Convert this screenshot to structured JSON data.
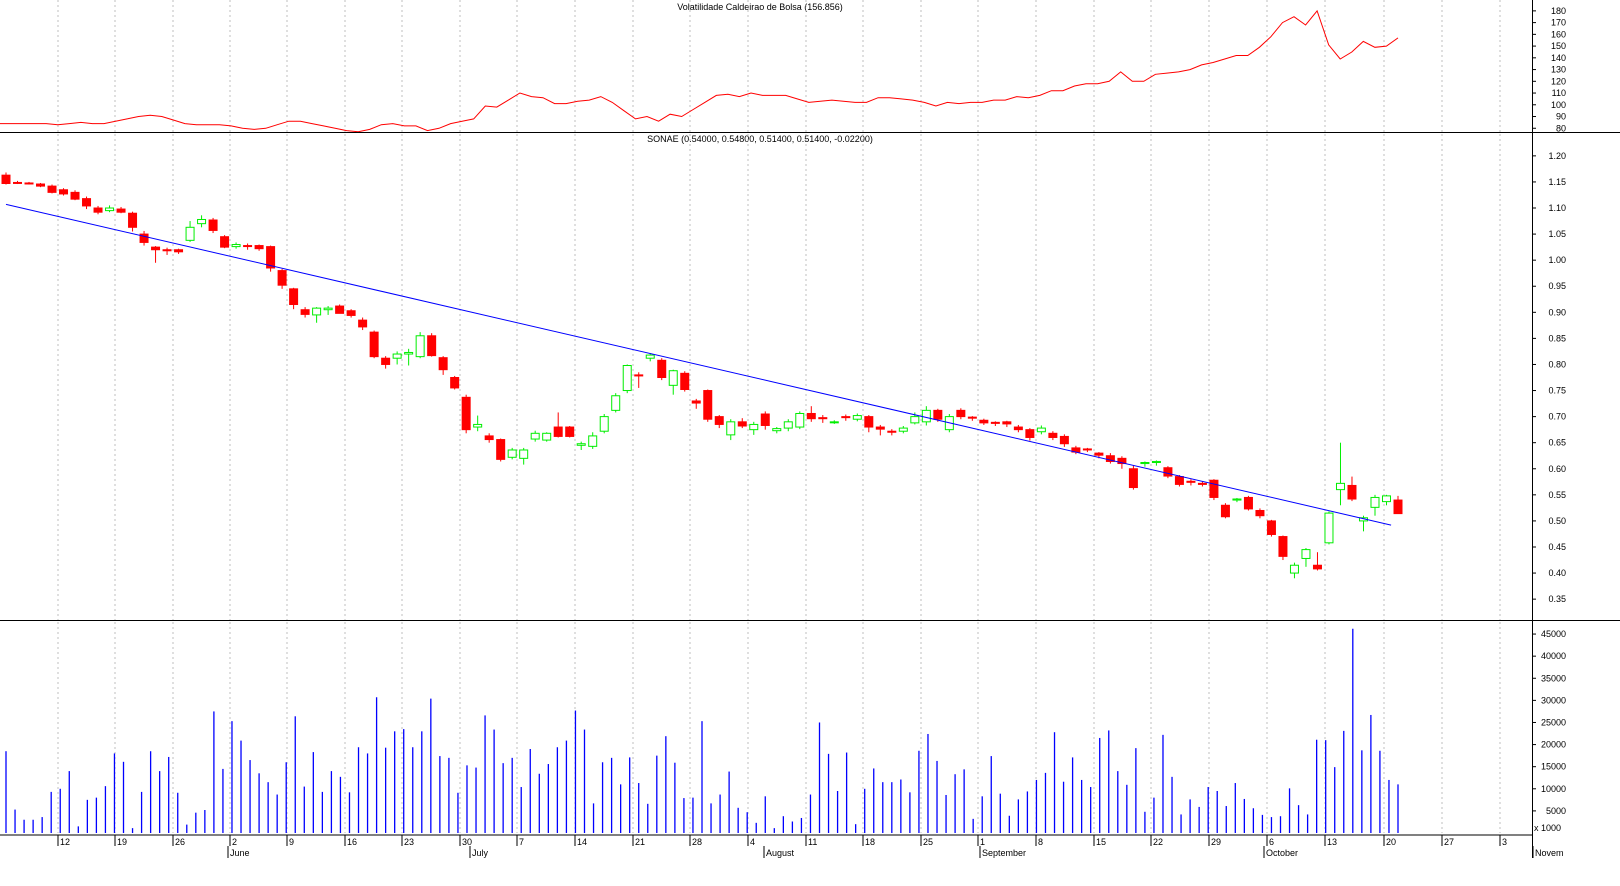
{
  "chart_data": [
    {
      "type": "line",
      "title": "Volatilidade Caldeirao de Bolsa (156.856)",
      "ylim": [
        70,
        185
      ],
      "yticks": [
        80,
        90,
        100,
        110,
        120,
        130,
        140,
        150,
        160,
        170,
        180
      ],
      "ytick_labels": [
        "80",
        "90",
        "100",
        "110",
        "120",
        "130",
        "140",
        "150",
        "160",
        "170",
        "180"
      ],
      "line_color": "#ff0000",
      "values": [
        84,
        84,
        84,
        84,
        84,
        83,
        84,
        85,
        84,
        84,
        86,
        88,
        90,
        91,
        90,
        87,
        84,
        83,
        83,
        83,
        82,
        80,
        79,
        80,
        83,
        86,
        86,
        84,
        82,
        80,
        78,
        77,
        79,
        83,
        84,
        82,
        82,
        78,
        80,
        84,
        86,
        88,
        99,
        98,
        104,
        110,
        107,
        106,
        101,
        101,
        103,
        104,
        107,
        102,
        95,
        88,
        90,
        86,
        92,
        90,
        96,
        102,
        108,
        109,
        107,
        110,
        108,
        108,
        108,
        105,
        102,
        103,
        104,
        103,
        102,
        102,
        106,
        106,
        105,
        104,
        102,
        99,
        102,
        101,
        102,
        102,
        104,
        104,
        107,
        106,
        108,
        112,
        112,
        116,
        118,
        118,
        120,
        128,
        120,
        120,
        126,
        127,
        128,
        130,
        134,
        136,
        139,
        142,
        142,
        149,
        158,
        170,
        175,
        168,
        180,
        151,
        139,
        145,
        154,
        149,
        150,
        157
      ]
    },
    {
      "type": "candlestick",
      "title": "SONAE (0.54000, 0.54800, 0.51400, 0.51400, -0.02200)",
      "ylim": [
        0.31,
        1.24
      ],
      "yticks": [
        0.35,
        0.4,
        0.45,
        0.5,
        0.55,
        0.6,
        0.65,
        0.7,
        0.75,
        0.8,
        0.85,
        0.9,
        0.95,
        1.0,
        1.05,
        1.1,
        1.15,
        1.2
      ],
      "ytick_labels": [
        "0.35",
        "0.40",
        "0.45",
        "0.50",
        "0.55",
        "0.60",
        "0.65",
        "0.70",
        "0.75",
        "0.80",
        "0.85",
        "0.90",
        "0.95",
        "1.00",
        "1.05",
        "1.10",
        "1.15",
        "1.20"
      ],
      "up_color": "#00ee00",
      "down_color": "#ff0000",
      "trendline": {
        "from": [
          0,
          1.107
        ],
        "to": [
          120.4,
          0.492
        ],
        "color": "#0000ff"
      },
      "ohlc": [
        [
          1.163,
          1.168,
          1.145,
          1.147
        ],
        [
          1.149,
          1.152,
          1.146,
          1.148
        ],
        [
          1.148,
          1.15,
          1.145,
          1.147
        ],
        [
          1.146,
          1.148,
          1.14,
          1.142
        ],
        [
          1.142,
          1.145,
          1.128,
          1.13
        ],
        [
          1.135,
          1.138,
          1.124,
          1.127
        ],
        [
          1.13,
          1.134,
          1.115,
          1.117
        ],
        [
          1.118,
          1.122,
          1.098,
          1.104
        ],
        [
          1.1,
          1.104,
          1.088,
          1.092
        ],
        [
          1.095,
          1.105,
          1.092,
          1.1
        ],
        [
          1.098,
          1.102,
          1.09,
          1.092
        ],
        [
          1.09,
          1.093,
          1.055,
          1.063
        ],
        [
          1.05,
          1.056,
          1.028,
          1.034
        ],
        [
          1.025,
          1.027,
          0.995,
          1.02
        ],
        [
          1.02,
          1.024,
          1.01,
          1.018
        ],
        [
          1.02,
          1.022,
          1.012,
          1.016
        ],
        [
          1.038,
          1.075,
          1.035,
          1.063
        ],
        [
          1.07,
          1.086,
          1.063,
          1.078
        ],
        [
          1.077,
          1.081,
          1.052,
          1.057
        ],
        [
          1.045,
          1.048,
          1.023,
          1.025
        ],
        [
          1.026,
          1.034,
          1.022,
          1.03
        ],
        [
          1.028,
          1.032,
          1.02,
          1.027
        ],
        [
          1.028,
          1.03,
          1.018,
          1.022
        ],
        [
          1.026,
          1.028,
          0.978,
          0.985
        ],
        [
          0.98,
          0.983,
          0.945,
          0.952
        ],
        [
          0.945,
          0.947,
          0.906,
          0.915
        ],
        [
          0.905,
          0.91,
          0.89,
          0.896
        ],
        [
          0.895,
          0.91,
          0.88,
          0.908
        ],
        [
          0.905,
          0.912,
          0.895,
          0.908
        ],
        [
          0.912,
          0.915,
          0.9,
          0.898
        ],
        [
          0.903,
          0.906,
          0.89,
          0.894
        ],
        [
          0.885,
          0.89,
          0.866,
          0.872
        ],
        [
          0.862,
          0.865,
          0.812,
          0.815
        ],
        [
          0.812,
          0.816,
          0.792,
          0.8
        ],
        [
          0.812,
          0.825,
          0.8,
          0.82
        ],
        [
          0.82,
          0.83,
          0.798,
          0.823
        ],
        [
          0.815,
          0.862,
          0.812,
          0.855
        ],
        [
          0.855,
          0.86,
          0.815,
          0.817
        ],
        [
          0.813,
          0.816,
          0.78,
          0.79
        ],
        [
          0.775,
          0.778,
          0.752,
          0.755
        ],
        [
          0.737,
          0.742,
          0.668,
          0.675
        ],
        [
          0.68,
          0.702,
          0.672,
          0.685
        ],
        [
          0.663,
          0.668,
          0.65,
          0.656
        ],
        [
          0.656,
          0.658,
          0.614,
          0.618
        ],
        [
          0.622,
          0.64,
          0.618,
          0.636
        ],
        [
          0.62,
          0.64,
          0.608,
          0.636
        ],
        [
          0.657,
          0.673,
          0.652,
          0.668
        ],
        [
          0.655,
          0.67,
          0.652,
          0.668
        ],
        [
          0.68,
          0.708,
          0.66,
          0.662
        ],
        [
          0.68,
          0.682,
          0.66,
          0.662
        ],
        [
          0.645,
          0.652,
          0.636,
          0.648
        ],
        [
          0.643,
          0.67,
          0.638,
          0.663
        ],
        [
          0.672,
          0.705,
          0.668,
          0.7
        ],
        [
          0.712,
          0.745,
          0.708,
          0.74
        ],
        [
          0.75,
          0.8,
          0.745,
          0.798
        ],
        [
          0.78,
          0.785,
          0.755,
          0.778
        ],
        [
          0.812,
          0.822,
          0.806,
          0.818
        ],
        [
          0.808,
          0.812,
          0.77,
          0.775
        ],
        [
          0.76,
          0.79,
          0.742,
          0.788
        ],
        [
          0.783,
          0.787,
          0.748,
          0.752
        ],
        [
          0.73,
          0.734,
          0.715,
          0.726
        ],
        [
          0.75,
          0.752,
          0.69,
          0.695
        ],
        [
          0.7,
          0.703,
          0.678,
          0.685
        ],
        [
          0.665,
          0.695,
          0.655,
          0.69
        ],
        [
          0.69,
          0.697,
          0.678,
          0.682
        ],
        [
          0.675,
          0.69,
          0.665,
          0.685
        ],
        [
          0.705,
          0.71,
          0.675,
          0.683
        ],
        [
          0.673,
          0.68,
          0.668,
          0.677
        ],
        [
          0.678,
          0.695,
          0.672,
          0.69
        ],
        [
          0.68,
          0.71,
          0.676,
          0.706
        ],
        [
          0.706,
          0.72,
          0.69,
          0.696
        ],
        [
          0.698,
          0.703,
          0.688,
          0.696
        ],
        [
          0.69,
          0.693,
          0.686,
          0.69
        ],
        [
          0.7,
          0.704,
          0.692,
          0.698
        ],
        [
          0.695,
          0.706,
          0.691,
          0.702
        ],
        [
          0.7,
          0.703,
          0.67,
          0.68
        ],
        [
          0.68,
          0.684,
          0.664,
          0.676
        ],
        [
          0.672,
          0.676,
          0.664,
          0.67
        ],
        [
          0.672,
          0.682,
          0.668,
          0.678
        ],
        [
          0.688,
          0.708,
          0.685,
          0.7
        ],
        [
          0.69,
          0.72,
          0.683,
          0.712
        ],
        [
          0.712,
          0.715,
          0.69,
          0.695
        ],
        [
          0.675,
          0.705,
          0.67,
          0.7
        ],
        [
          0.712,
          0.716,
          0.695,
          0.7
        ],
        [
          0.699,
          0.701,
          0.692,
          0.697
        ],
        [
          0.693,
          0.696,
          0.684,
          0.688
        ],
        [
          0.689,
          0.691,
          0.682,
          0.687
        ],
        [
          0.69,
          0.692,
          0.68,
          0.686
        ],
        [
          0.68,
          0.684,
          0.67,
          0.675
        ],
        [
          0.675,
          0.678,
          0.654,
          0.66
        ],
        [
          0.671,
          0.683,
          0.666,
          0.678
        ],
        [
          0.668,
          0.672,
          0.655,
          0.66
        ],
        [
          0.662,
          0.666,
          0.642,
          0.648
        ],
        [
          0.64,
          0.644,
          0.628,
          0.632
        ],
        [
          0.638,
          0.64,
          0.632,
          0.637
        ],
        [
          0.63,
          0.632,
          0.62,
          0.626
        ],
        [
          0.625,
          0.63,
          0.61,
          0.614
        ],
        [
          0.62,
          0.624,
          0.6,
          0.61
        ],
        [
          0.6,
          0.606,
          0.56,
          0.564
        ],
        [
          0.61,
          0.614,
          0.604,
          0.612
        ],
        [
          0.612,
          0.616,
          0.606,
          0.614
        ],
        [
          0.602,
          0.605,
          0.582,
          0.586
        ],
        [
          0.585,
          0.588,
          0.566,
          0.57
        ],
        [
          0.576,
          0.58,
          0.568,
          0.574
        ],
        [
          0.572,
          0.576,
          0.566,
          0.57
        ],
        [
          0.578,
          0.58,
          0.54,
          0.545
        ],
        [
          0.53,
          0.534,
          0.505,
          0.508
        ],
        [
          0.54,
          0.544,
          0.536,
          0.542
        ],
        [
          0.545,
          0.548,
          0.52,
          0.523
        ],
        [
          0.52,
          0.524,
          0.505,
          0.51
        ],
        [
          0.5,
          0.502,
          0.47,
          0.474
        ],
        [
          0.47,
          0.472,
          0.425,
          0.432
        ],
        [
          0.4,
          0.42,
          0.39,
          0.415
        ],
        [
          0.428,
          0.448,
          0.412,
          0.445
        ],
        [
          0.415,
          0.44,
          0.405,
          0.408
        ],
        [
          0.458,
          0.518,
          0.455,
          0.515
        ],
        [
          0.56,
          0.65,
          0.53,
          0.572
        ],
        [
          0.568,
          0.585,
          0.538,
          0.542
        ],
        [
          0.5,
          0.51,
          0.48,
          0.506
        ],
        [
          0.526,
          0.55,
          0.51,
          0.545
        ],
        [
          0.537,
          0.55,
          0.53,
          0.548
        ],
        [
          0.54,
          0.548,
          0.514,
          0.514
        ]
      ]
    },
    {
      "type": "bar",
      "title": "",
      "ylim": [
        0,
        47500
      ],
      "yticks": [
        5000,
        10000,
        15000,
        20000,
        25000,
        30000,
        35000,
        40000,
        45000
      ],
      "ytick_labels": [
        "5000",
        "10000",
        "15000",
        "20000",
        "25000",
        "30000",
        "35000",
        "40000",
        "45000"
      ],
      "corner_label": "x 1000",
      "bar_color": "#0000ff",
      "values": [
        18500,
        5300,
        3000,
        3000,
        3600,
        9300,
        10000,
        14000,
        1500,
        7500,
        8000,
        10600,
        18000,
        16100,
        1100,
        9300,
        18500,
        14000,
        17200,
        9100,
        1900,
        4600,
        5200,
        27500,
        14500,
        25300,
        20900,
        16500,
        13500,
        11500,
        8700,
        16000,
        26400,
        10500,
        18300,
        9300,
        14000,
        12700,
        9200,
        19400,
        18000,
        30700,
        19300,
        23000,
        23500,
        19400,
        23000,
        30400,
        17400,
        17000,
        9100,
        15300,
        14800,
        26600,
        23400,
        15800,
        17000,
        10400,
        19000,
        13400,
        15600,
        19400,
        20900,
        27700,
        23400,
        6700,
        16000,
        17000,
        11000,
        17100,
        11300,
        6600,
        17500,
        21900,
        15900,
        7900,
        8000,
        25300,
        6700,
        8700,
        13900,
        5700,
        4700,
        2300,
        8300,
        1100,
        3800,
        2600,
        3400,
        8700,
        25000,
        17900,
        9500,
        18200,
        2000,
        10000,
        14600,
        11500,
        11500,
        12100,
        9200,
        18600,
        22400,
        16300,
        8600,
        13300,
        14400,
        3200,
        8300,
        17400,
        8900,
        3900,
        7600,
        9400,
        12000,
        13600,
        22800,
        11600,
        17100,
        12000,
        10400,
        21500,
        23200,
        14000,
        10900,
        19200,
        4800,
        8000,
        22200,
        12700,
        4200,
        7600,
        5900,
        10400,
        9500,
        6100,
        11300,
        7700,
        5600,
        4100,
        3600,
        3800,
        10100,
        6300,
        4200,
        21100,
        21000,
        14900,
        23100,
        46200,
        18700,
        26700,
        18600,
        12000,
        11000
      ]
    }
  ],
  "x_axis": {
    "tick_labels": [
      "12",
      "19",
      "26",
      "2",
      "9",
      "16",
      "23",
      "30",
      "7",
      "14",
      "21",
      "28",
      "4",
      "11",
      "18",
      "25",
      "1",
      "8",
      "15",
      "22",
      "29",
      "6",
      "13",
      "20",
      "27",
      "3"
    ],
    "month_labels": [
      "June",
      "July",
      "August",
      "September",
      "October",
      "Novem"
    ]
  }
}
